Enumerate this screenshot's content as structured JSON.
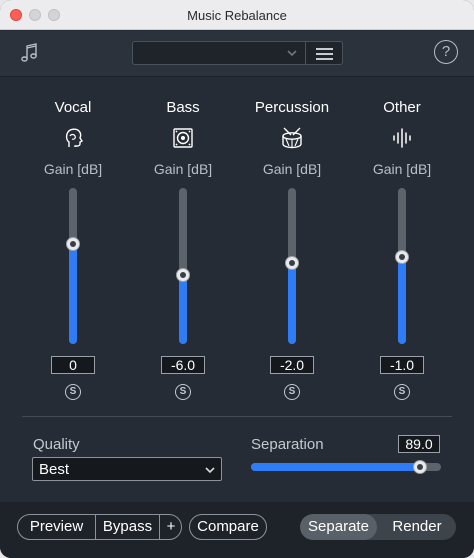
{
  "window": {
    "title": "Music Rebalance"
  },
  "toolbar": {
    "preset_value": "",
    "app_icon": "music-note-icon",
    "menu_icon": "hamburger-icon",
    "help_label": "?"
  },
  "stems": [
    {
      "name": "Vocal",
      "icon": "vocal-head-icon",
      "gain_label": "Gain [dB]",
      "value": "0",
      "level": 0.64,
      "solo": "S"
    },
    {
      "name": "Bass",
      "icon": "speaker-icon",
      "gain_label": "Gain [dB]",
      "value": "-6.0",
      "level": 0.44,
      "solo": "S"
    },
    {
      "name": "Percussion",
      "icon": "drum-icon",
      "gain_label": "Gain [dB]",
      "value": "-2.0",
      "level": 0.52,
      "solo": "S"
    },
    {
      "name": "Other",
      "icon": "waveform-icon",
      "gain_label": "Gain [dB]",
      "value": "-1.0",
      "level": 0.56,
      "solo": "S"
    }
  ],
  "quality": {
    "label": "Quality",
    "value": "Best"
  },
  "separation": {
    "label": "Separation",
    "value": "89.0",
    "level": 0.89
  },
  "bottom": {
    "preview": "Preview",
    "bypass": "Bypass",
    "add": "+",
    "compare": "Compare",
    "separate": "Separate",
    "render": "Render"
  },
  "colors": {
    "accent": "#2f7cf6",
    "panel": "#262c35",
    "bar": "#1e232a"
  }
}
